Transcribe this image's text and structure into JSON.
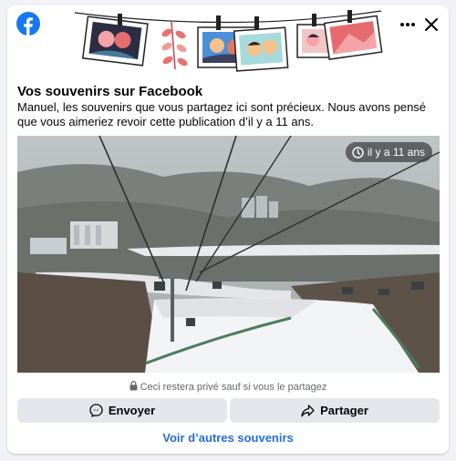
{
  "app": {
    "name": "Facebook",
    "logo_icon": "facebook-logo-icon",
    "brand_color": "#1877f2"
  },
  "dialog": {
    "title": "Vos souvenirs sur Facebook",
    "description": "Manuel, les souvenirs que vous partagez ici sont précieux. Nous avons pensé que vous aimeriez revoir cette publication d’il y a 11 ans.",
    "more_icon": "more-options-icon",
    "close_icon": "close-icon"
  },
  "memory": {
    "time_badge": "il y a 11 ans",
    "time_icon": "clock-icon",
    "photo_subject": "cable car over ski slope"
  },
  "privacy_note": "Ceci restera privé sauf si vous le partagez",
  "privacy_icon": "lock-icon",
  "actions": {
    "send_label": "Envoyer",
    "send_icon": "messenger-icon",
    "share_label": "Partager",
    "share_icon": "share-icon",
    "more_memories_label": "Voir d’autres souvenirs"
  },
  "colors": {
    "link": "#216fdb",
    "button_bg": "#e4e6eb",
    "text": "#050505",
    "muted": "#65676b"
  }
}
